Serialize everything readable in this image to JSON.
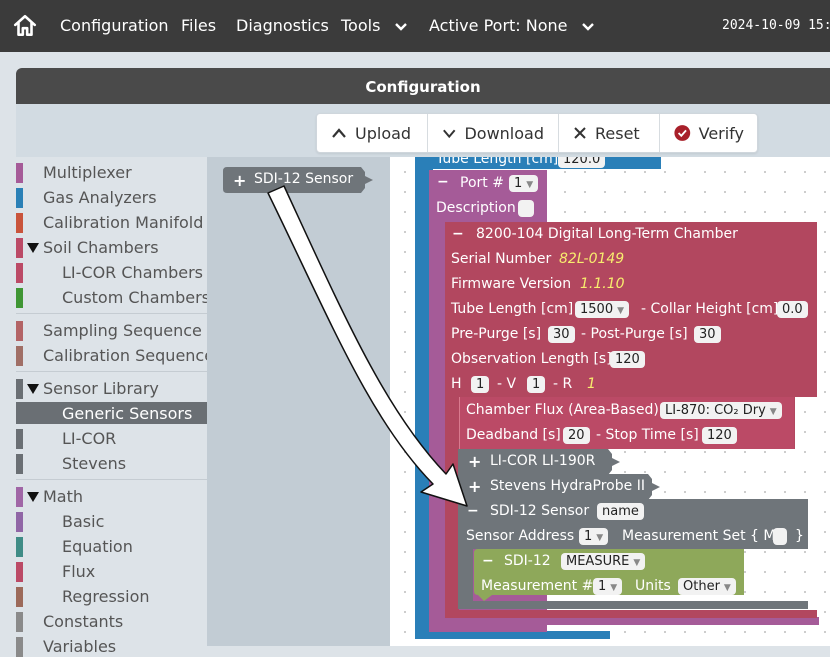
{
  "nav": {
    "items": [
      {
        "label": "Configuration"
      },
      {
        "label": "Files"
      },
      {
        "label": "Diagnostics"
      },
      {
        "label": "Tools"
      },
      {
        "label": "Active Port: None"
      }
    ],
    "timestamp": "2024-10-09 15:"
  },
  "panel": {
    "title": "Configuration"
  },
  "toolbar": {
    "upload": "Upload",
    "download": "Download",
    "reset": "Reset",
    "verify": "Verify"
  },
  "sidebar": {
    "items": [
      {
        "label": "Multiplexer",
        "color": "#a55b98"
      },
      {
        "label": "Gas Analyzers",
        "color": "#2a80b6"
      },
      {
        "label": "Calibration Manifold",
        "color": "#c9543b"
      },
      {
        "label": "Soil Chambers",
        "color": "#bb4a66"
      },
      {
        "label": "LI-COR Chambers",
        "color": "#bb4a66"
      },
      {
        "label": "Custom Chambers",
        "color": "#3f9634"
      },
      {
        "label": "Sampling Sequence",
        "color": "#b36466"
      },
      {
        "label": "Calibration Sequence",
        "color": "#a06f66"
      },
      {
        "label": "Sensor Library",
        "color": "#6a6f74"
      },
      {
        "label": "Generic Sensors",
        "color": "#6a6f74"
      },
      {
        "label": "LI-COR",
        "color": "#6a6f74"
      },
      {
        "label": "Stevens",
        "color": "#6a6f74"
      },
      {
        "label": "Math",
        "color": "#a066a6"
      },
      {
        "label": "Basic",
        "color": "#9066a6"
      },
      {
        "label": "Equation",
        "color": "#3f8c86"
      },
      {
        "label": "Flux",
        "color": "#bb4a66"
      },
      {
        "label": "Regression",
        "color": "#9c6a5a"
      },
      {
        "label": "Constants",
        "color": "#8a8a8a"
      },
      {
        "label": "Variables",
        "color": "#8a8a8a"
      }
    ]
  },
  "flyout": {
    "block_label": "SDI-12 Sensor"
  },
  "workspace": {
    "tube_length_top": "Tube Length [cm]",
    "tube_length_top_value": "120.0",
    "port_label": "Port #",
    "port_value": "1",
    "description_label": "Description",
    "chamber_title": "8200-104 Digital Long-Term Chamber",
    "serial_label": "Serial Number",
    "serial_value": "82L-0149",
    "firmware_label": "Firmware Version",
    "firmware_value": "1.1.10",
    "tube_label": "Tube Length [cm]",
    "tube_value": "1500",
    "collar_label": "- Collar Height [cm]",
    "collar_value": "0.0",
    "prepurge_label": "Pre-Purge [s]",
    "prepurge_value": "30",
    "postpurge_label": "- Post-Purge [s]",
    "postpurge_value": "30",
    "obs_label": "Observation Length [s]",
    "obs_value": "120",
    "h_label": "H",
    "h_value": "1",
    "v_label": "- V",
    "v_value": "1",
    "r_label": "- R",
    "r_value": "1",
    "flux_label": "Chamber Flux (Area-Based):",
    "flux_value": "LI-870: CO₂ Dry",
    "deadband_label": "Deadband [s]",
    "deadband_value": "20",
    "stop_label": "- Stop Time [s]",
    "stop_value": "120",
    "licor_sensor": "LI-COR LI-190R",
    "stevens_sensor": "Stevens HydraProbe II",
    "sdi_title": "SDI-12 Sensor",
    "sdi_name": "name",
    "sensor_address_label": "Sensor Address",
    "sensor_address_value": "1",
    "meas_set_label": "Measurement Set { M",
    "meas_set_close": "}",
    "sdi12_label": "SDI-12",
    "sdi12_cmd": "MEASURE",
    "meas_num_label": "Measurement #",
    "meas_num_value": "1",
    "units_label": "Units",
    "units_value": "Other"
  }
}
